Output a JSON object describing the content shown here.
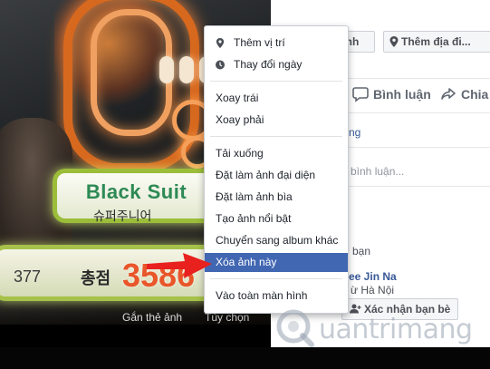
{
  "photo": {
    "scoreboard_name": "Black Suit",
    "scoreboard_sub": "슈퍼주니어",
    "bottom_left_number": "377",
    "score_label": "총점",
    "score_value": "3586",
    "footer": {
      "tag_link": "Gắn thẻ ảnh",
      "options_link": "Tùy chọn"
    }
  },
  "panel": {
    "tag_button_partial": "ảnh",
    "add_place_button": "Thêm địa đi...",
    "actions": {
      "comment": "Bình luận",
      "share": "Chia"
    },
    "link_fragment": "ng",
    "comment_placeholder": "bình luận...",
    "friend_label": "bạn",
    "friend_name": "ee Jin Na",
    "friend_location": "ừ Hà Nội",
    "confirm_friend_button": "Xác nhận bạn bè"
  },
  "menu": {
    "items": [
      {
        "label": "Thêm vị trí",
        "icon": "location-pin-icon"
      },
      {
        "label": "Thay đổi ngày",
        "icon": "clock-icon"
      },
      {
        "label": "Xoay trái"
      },
      {
        "label": "Xoay phải"
      },
      {
        "label": "Tải xuống"
      },
      {
        "label": "Đặt làm ảnh đại diện"
      },
      {
        "label": "Đặt làm ảnh bìa"
      },
      {
        "label": "Tạo ảnh nổi bật"
      },
      {
        "label": "Chuyển sang album khác"
      },
      {
        "label": "Xóa ảnh này",
        "active": true
      },
      {
        "label": "Vào toàn màn hình"
      }
    ]
  },
  "watermark": {
    "text": "uantrimang"
  },
  "colors": {
    "facebook_blue": "#4267b2",
    "arrow_red": "#e8201e",
    "link_blue": "#385898"
  }
}
